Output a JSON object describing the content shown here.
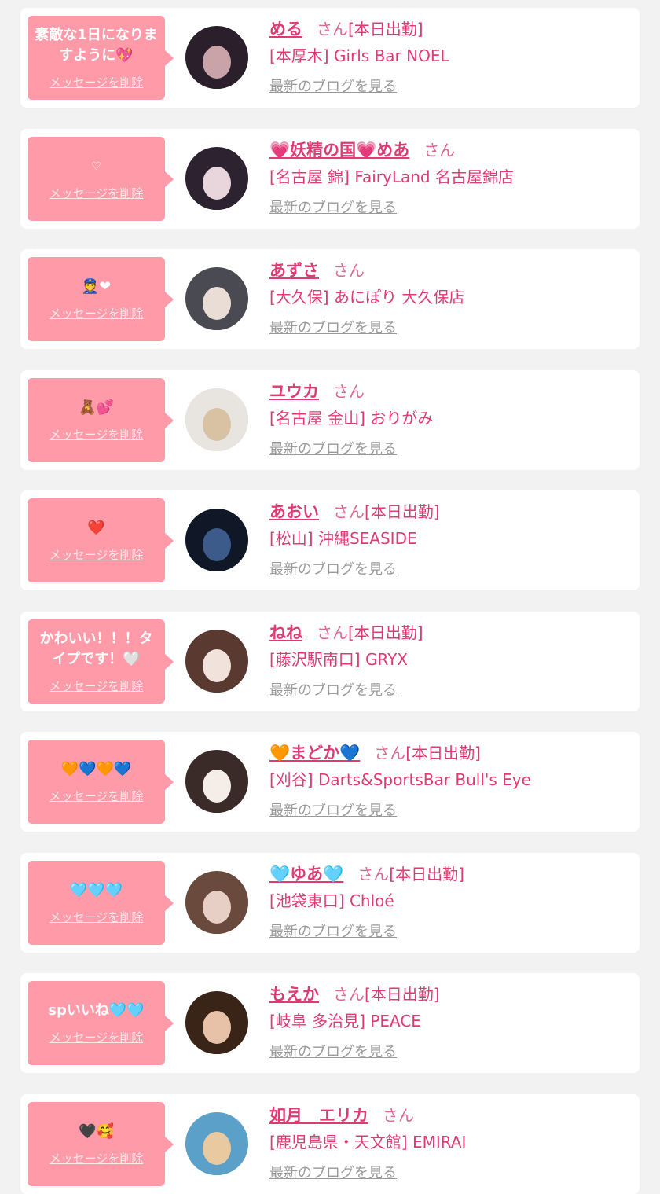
{
  "colors": {
    "page_bg": "#f2f2f2",
    "card_bg": "#ffffff",
    "bubble_bg": "#ff9aa8",
    "name_color": "#e03a72",
    "blog_link_color": "#9a9a9a"
  },
  "entries": [
    {
      "message": "素敵な1日になりますように💖",
      "delete_label": "メッセージを削除",
      "name": "める",
      "honorific": "さん",
      "status": "[本日出勤]",
      "shop": "[本厚木] Girls Bar NOEL",
      "blog_link": "最新のブログを見る",
      "avatar_colors": [
        "#2a1f2a",
        "#c9a3a8"
      ]
    },
    {
      "message": "♡",
      "delete_label": "メッセージを削除",
      "name": "💗妖精の国💗めあ",
      "honorific": "さん",
      "status": "",
      "shop": "[名古屋 錦] FairyLand 名古屋錦店",
      "blog_link": "最新のブログを見る",
      "avatar_colors": [
        "#2c2230",
        "#e8d6dc"
      ]
    },
    {
      "message": "👮❤",
      "delete_label": "メッセージを削除",
      "name": "あずさ",
      "honorific": "さん",
      "status": "",
      "shop": "[大久保] あにぽり 大久保店",
      "blog_link": "最新のブログを見る",
      "avatar_colors": [
        "#4a4a52",
        "#e9ddd5"
      ]
    },
    {
      "message": "🧸💕",
      "delete_label": "メッセージを削除",
      "name": "ユウカ",
      "honorific": "さん",
      "status": "",
      "shop": "[名古屋 金山] おりがみ",
      "blog_link": "最新のブログを見る",
      "avatar_colors": [
        "#e8e4e0",
        "#d9c2a4"
      ]
    },
    {
      "message": "❤️",
      "delete_label": "メッセージを削除",
      "name": "あおい",
      "honorific": "さん",
      "status": "[本日出勤]",
      "shop": "[松山] 沖縄SEASIDE",
      "blog_link": "最新のブログを見る",
      "avatar_colors": [
        "#101828",
        "#3c5a8a"
      ]
    },
    {
      "message": "かわいい！！！タイプです！🤍",
      "delete_label": "メッセージを削除",
      "name": "ねね",
      "honorific": "さん",
      "status": "[本日出勤]",
      "shop": "[藤沢駅南口] GRYX",
      "blog_link": "最新のブログを見る",
      "avatar_colors": [
        "#5a3a30",
        "#f2e2dc"
      ]
    },
    {
      "message": "🧡💙🧡💙",
      "delete_label": "メッセージを削除",
      "name": "🧡まどか💙",
      "honorific": "さん",
      "status": "[本日出勤]",
      "shop": "[刈谷] Darts&SportsBar Bull's Eye",
      "blog_link": "最新のブログを見る",
      "avatar_colors": [
        "#3a2a28",
        "#f4ede8"
      ]
    },
    {
      "message": "🩵🩵🩵",
      "delete_label": "メッセージを削除",
      "name": "🩵ゆあ🩵",
      "honorific": "さん",
      "status": "[本日出勤]",
      "shop": "[池袋東口] Chloé",
      "blog_link": "最新のブログを見る",
      "avatar_colors": [
        "#6a4a3c",
        "#e7cfc5"
      ]
    },
    {
      "message": "spいいね🩵🩵",
      "delete_label": "メッセージを削除",
      "name": "もえか",
      "honorific": "さん",
      "status": "[本日出勤]",
      "shop": "[岐阜 多治見] PEACE",
      "blog_link": "最新のブログを見る",
      "avatar_colors": [
        "#3a2418",
        "#e8c2a8"
      ]
    },
    {
      "message": "🖤🥰",
      "delete_label": "メッセージを削除",
      "name": "如月　エリカ",
      "honorific": "さん",
      "status": "",
      "shop": "[鹿児島県・天文館] EMIRAI",
      "blog_link": "最新のブログを見る",
      "avatar_colors": [
        "#5aa0c8",
        "#e8c9a0"
      ]
    }
  ]
}
